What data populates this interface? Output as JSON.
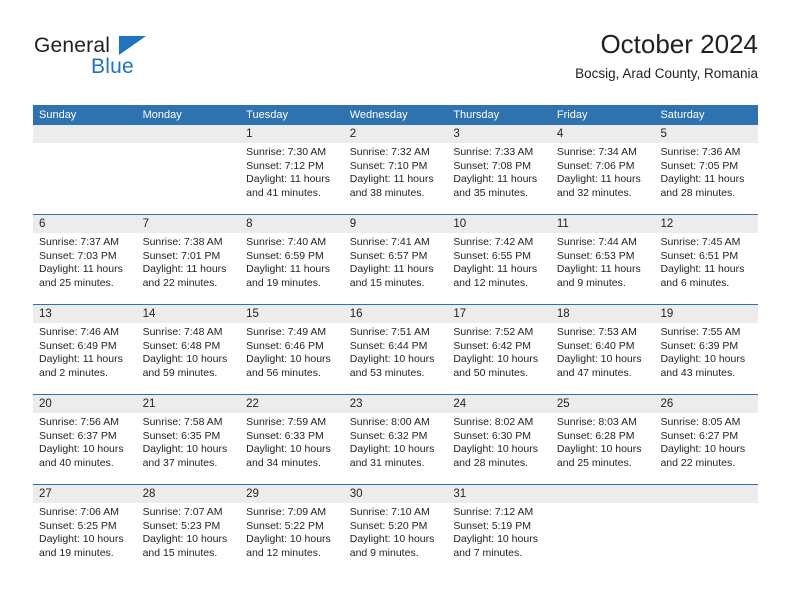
{
  "logo": {
    "line1": "General",
    "line2": "Blue",
    "triangle_icon": "blue-triangle-icon",
    "accent_color": "#1f74bb"
  },
  "header": {
    "title": "October 2024",
    "subtitle": "Bocsig, Arad County, Romania"
  },
  "theme": {
    "header_blue": "#2e72b0",
    "day_band_gray": "#ececec",
    "text": "#231f20"
  },
  "calendar": {
    "weekdays": [
      "Sunday",
      "Monday",
      "Tuesday",
      "Wednesday",
      "Thursday",
      "Friday",
      "Saturday"
    ],
    "weeks": [
      [
        {
          "day": "",
          "empty": true
        },
        {
          "day": "",
          "empty": true
        },
        {
          "day": "1",
          "sunrise": "Sunrise: 7:30 AM",
          "sunset": "Sunset: 7:12 PM",
          "daylight1": "Daylight: 11 hours",
          "daylight2": "and 41 minutes."
        },
        {
          "day": "2",
          "sunrise": "Sunrise: 7:32 AM",
          "sunset": "Sunset: 7:10 PM",
          "daylight1": "Daylight: 11 hours",
          "daylight2": "and 38 minutes."
        },
        {
          "day": "3",
          "sunrise": "Sunrise: 7:33 AM",
          "sunset": "Sunset: 7:08 PM",
          "daylight1": "Daylight: 11 hours",
          "daylight2": "and 35 minutes."
        },
        {
          "day": "4",
          "sunrise": "Sunrise: 7:34 AM",
          "sunset": "Sunset: 7:06 PM",
          "daylight1": "Daylight: 11 hours",
          "daylight2": "and 32 minutes."
        },
        {
          "day": "5",
          "sunrise": "Sunrise: 7:36 AM",
          "sunset": "Sunset: 7:05 PM",
          "daylight1": "Daylight: 11 hours",
          "daylight2": "and 28 minutes."
        }
      ],
      [
        {
          "day": "6",
          "sunrise": "Sunrise: 7:37 AM",
          "sunset": "Sunset: 7:03 PM",
          "daylight1": "Daylight: 11 hours",
          "daylight2": "and 25 minutes."
        },
        {
          "day": "7",
          "sunrise": "Sunrise: 7:38 AM",
          "sunset": "Sunset: 7:01 PM",
          "daylight1": "Daylight: 11 hours",
          "daylight2": "and 22 minutes."
        },
        {
          "day": "8",
          "sunrise": "Sunrise: 7:40 AM",
          "sunset": "Sunset: 6:59 PM",
          "daylight1": "Daylight: 11 hours",
          "daylight2": "and 19 minutes."
        },
        {
          "day": "9",
          "sunrise": "Sunrise: 7:41 AM",
          "sunset": "Sunset: 6:57 PM",
          "daylight1": "Daylight: 11 hours",
          "daylight2": "and 15 minutes."
        },
        {
          "day": "10",
          "sunrise": "Sunrise: 7:42 AM",
          "sunset": "Sunset: 6:55 PM",
          "daylight1": "Daylight: 11 hours",
          "daylight2": "and 12 minutes."
        },
        {
          "day": "11",
          "sunrise": "Sunrise: 7:44 AM",
          "sunset": "Sunset: 6:53 PM",
          "daylight1": "Daylight: 11 hours",
          "daylight2": "and 9 minutes."
        },
        {
          "day": "12",
          "sunrise": "Sunrise: 7:45 AM",
          "sunset": "Sunset: 6:51 PM",
          "daylight1": "Daylight: 11 hours",
          "daylight2": "and 6 minutes."
        }
      ],
      [
        {
          "day": "13",
          "sunrise": "Sunrise: 7:46 AM",
          "sunset": "Sunset: 6:49 PM",
          "daylight1": "Daylight: 11 hours",
          "daylight2": "and 2 minutes."
        },
        {
          "day": "14",
          "sunrise": "Sunrise: 7:48 AM",
          "sunset": "Sunset: 6:48 PM",
          "daylight1": "Daylight: 10 hours",
          "daylight2": "and 59 minutes."
        },
        {
          "day": "15",
          "sunrise": "Sunrise: 7:49 AM",
          "sunset": "Sunset: 6:46 PM",
          "daylight1": "Daylight: 10 hours",
          "daylight2": "and 56 minutes."
        },
        {
          "day": "16",
          "sunrise": "Sunrise: 7:51 AM",
          "sunset": "Sunset: 6:44 PM",
          "daylight1": "Daylight: 10 hours",
          "daylight2": "and 53 minutes."
        },
        {
          "day": "17",
          "sunrise": "Sunrise: 7:52 AM",
          "sunset": "Sunset: 6:42 PM",
          "daylight1": "Daylight: 10 hours",
          "daylight2": "and 50 minutes."
        },
        {
          "day": "18",
          "sunrise": "Sunrise: 7:53 AM",
          "sunset": "Sunset: 6:40 PM",
          "daylight1": "Daylight: 10 hours",
          "daylight2": "and 47 minutes."
        },
        {
          "day": "19",
          "sunrise": "Sunrise: 7:55 AM",
          "sunset": "Sunset: 6:39 PM",
          "daylight1": "Daylight: 10 hours",
          "daylight2": "and 43 minutes."
        }
      ],
      [
        {
          "day": "20",
          "sunrise": "Sunrise: 7:56 AM",
          "sunset": "Sunset: 6:37 PM",
          "daylight1": "Daylight: 10 hours",
          "daylight2": "and 40 minutes."
        },
        {
          "day": "21",
          "sunrise": "Sunrise: 7:58 AM",
          "sunset": "Sunset: 6:35 PM",
          "daylight1": "Daylight: 10 hours",
          "daylight2": "and 37 minutes."
        },
        {
          "day": "22",
          "sunrise": "Sunrise: 7:59 AM",
          "sunset": "Sunset: 6:33 PM",
          "daylight1": "Daylight: 10 hours",
          "daylight2": "and 34 minutes."
        },
        {
          "day": "23",
          "sunrise": "Sunrise: 8:00 AM",
          "sunset": "Sunset: 6:32 PM",
          "daylight1": "Daylight: 10 hours",
          "daylight2": "and 31 minutes."
        },
        {
          "day": "24",
          "sunrise": "Sunrise: 8:02 AM",
          "sunset": "Sunset: 6:30 PM",
          "daylight1": "Daylight: 10 hours",
          "daylight2": "and 28 minutes."
        },
        {
          "day": "25",
          "sunrise": "Sunrise: 8:03 AM",
          "sunset": "Sunset: 6:28 PM",
          "daylight1": "Daylight: 10 hours",
          "daylight2": "and 25 minutes."
        },
        {
          "day": "26",
          "sunrise": "Sunrise: 8:05 AM",
          "sunset": "Sunset: 6:27 PM",
          "daylight1": "Daylight: 10 hours",
          "daylight2": "and 22 minutes."
        }
      ],
      [
        {
          "day": "27",
          "sunrise": "Sunrise: 7:06 AM",
          "sunset": "Sunset: 5:25 PM",
          "daylight1": "Daylight: 10 hours",
          "daylight2": "and 19 minutes."
        },
        {
          "day": "28",
          "sunrise": "Sunrise: 7:07 AM",
          "sunset": "Sunset: 5:23 PM",
          "daylight1": "Daylight: 10 hours",
          "daylight2": "and 15 minutes."
        },
        {
          "day": "29",
          "sunrise": "Sunrise: 7:09 AM",
          "sunset": "Sunset: 5:22 PM",
          "daylight1": "Daylight: 10 hours",
          "daylight2": "and 12 minutes."
        },
        {
          "day": "30",
          "sunrise": "Sunrise: 7:10 AM",
          "sunset": "Sunset: 5:20 PM",
          "daylight1": "Daylight: 10 hours",
          "daylight2": "and 9 minutes."
        },
        {
          "day": "31",
          "sunrise": "Sunrise: 7:12 AM",
          "sunset": "Sunset: 5:19 PM",
          "daylight1": "Daylight: 10 hours",
          "daylight2": "and 7 minutes."
        },
        {
          "day": "",
          "empty": true
        },
        {
          "day": "",
          "empty": true
        }
      ]
    ]
  }
}
